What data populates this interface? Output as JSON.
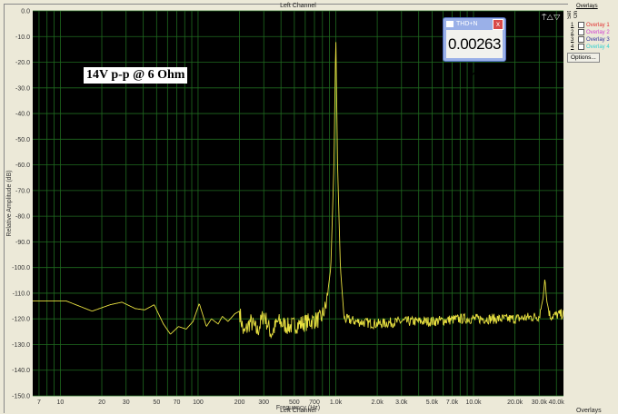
{
  "window_title": "Left Channel",
  "bottom_title": "Left Channel",
  "bottom_right": "Overlays",
  "annotation": "14V p-p @ 6 Ohm",
  "thd_panel": {
    "title": "THD+N",
    "value": "0.00263 %",
    "close": "x"
  },
  "overlays": {
    "header": "Overlays",
    "col_set": "Set",
    "col_on": "On",
    "items": [
      {
        "n": "1",
        "label": "Overlay 1",
        "color": "#e03030"
      },
      {
        "n": "2",
        "label": "Overlay 2",
        "color": "#d040d0"
      },
      {
        "n": "3",
        "label": "Overlay 3",
        "color": "#3030a0"
      },
      {
        "n": "4",
        "label": "Overlay 4",
        "color": "#30d0d0"
      }
    ],
    "options": "Options..."
  },
  "chart_data": {
    "type": "line",
    "title": "Left Channel",
    "xlabel": "Frequency (Hz)",
    "ylabel": "Relative Amplitude (dB)",
    "xscale": "log",
    "xlim": [
      6.3,
      45000
    ],
    "ylim": [
      -150,
      0
    ],
    "grid": true,
    "yticks": [
      "0.0",
      "-10.0",
      "-20.0",
      "-30.0",
      "-40.0",
      "-50.0",
      "-60.0",
      "-70.0",
      "-80.0",
      "-90.0",
      "-100.0",
      "-110.0",
      "-120.0",
      "-130.0",
      "-140.0",
      "-150.0"
    ],
    "xticks": [
      {
        "v": 7,
        "l": "7"
      },
      {
        "v": 10,
        "l": "10"
      },
      {
        "v": 20,
        "l": "20"
      },
      {
        "v": 30,
        "l": "30"
      },
      {
        "v": 50,
        "l": "50"
      },
      {
        "v": 70,
        "l": "70"
      },
      {
        "v": 100,
        "l": "100"
      },
      {
        "v": 200,
        "l": "200"
      },
      {
        "v": 300,
        "l": "300"
      },
      {
        "v": 500,
        "l": "500"
      },
      {
        "v": 700,
        "l": "700"
      },
      {
        "v": 1000,
        "l": "1.0k"
      },
      {
        "v": 2000,
        "l": "2.0k"
      },
      {
        "v": 3000,
        "l": "3.0k"
      },
      {
        "v": 5000,
        "l": "5.0k"
      },
      {
        "v": 7000,
        "l": "7.0k"
      },
      {
        "v": 10000,
        "l": "10.0k"
      },
      {
        "v": 20000,
        "l": "20.0k"
      },
      {
        "v": 30000,
        "l": "30.0k"
      },
      {
        "v": 40000,
        "l": "40.0k"
      }
    ],
    "series": [
      {
        "name": "Left Channel",
        "color": "#e8e040",
        "points": [
          [
            6.3,
            -113
          ],
          [
            11,
            -113
          ],
          [
            17,
            -117
          ],
          [
            23,
            -114.5
          ],
          [
            28,
            -113.5
          ],
          [
            35,
            -116
          ],
          [
            41,
            -116.5
          ],
          [
            48,
            -114.5
          ],
          [
            56,
            -122
          ],
          [
            63,
            -126
          ],
          [
            72,
            -123
          ],
          [
            82,
            -124
          ],
          [
            92,
            -121
          ],
          [
            102,
            -114
          ],
          [
            115,
            -123
          ],
          [
            125,
            -120
          ],
          [
            140,
            -122
          ],
          [
            150,
            -119
          ],
          [
            165,
            -121
          ],
          [
            185,
            -118
          ],
          [
            200,
            -117
          ],
          [
            215,
            -126
          ],
          [
            240,
            -121
          ],
          [
            270,
            -125
          ],
          [
            300,
            -118
          ],
          [
            340,
            -126
          ],
          [
            380,
            -121
          ],
          [
            450,
            -123
          ],
          [
            550,
            -122
          ],
          [
            650,
            -121
          ],
          [
            780,
            -120
          ],
          [
            850,
            -115
          ],
          [
            920,
            -100
          ],
          [
            970,
            -60
          ],
          [
            1000,
            -9
          ],
          [
            1030,
            -60
          ],
          [
            1080,
            -100
          ],
          [
            1150,
            -120
          ],
          [
            1400,
            -121
          ],
          [
            2000,
            -122
          ],
          [
            3000,
            -121
          ],
          [
            5000,
            -121
          ],
          [
            8000,
            -120
          ],
          [
            12000,
            -120
          ],
          [
            20000,
            -120
          ],
          [
            30000,
            -119
          ],
          [
            32000,
            -112
          ],
          [
            33000,
            -104
          ],
          [
            34000,
            -113
          ],
          [
            36000,
            -119
          ],
          [
            45000,
            -118
          ]
        ]
      }
    ]
  }
}
